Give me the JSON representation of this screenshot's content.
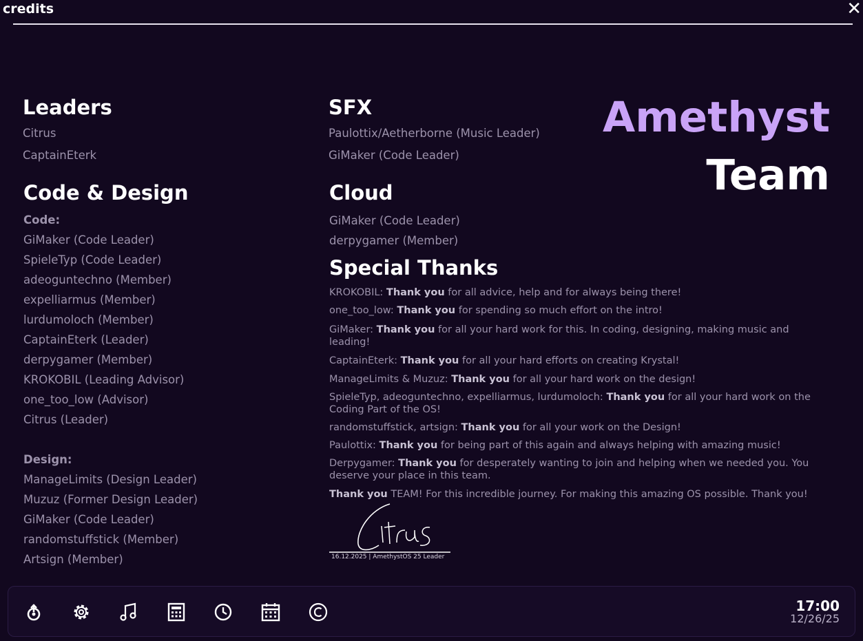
{
  "window": {
    "title": "credits",
    "close_symbol": "✕"
  },
  "colors": {
    "background": "#12081f",
    "accent": "#c9a3f7",
    "muted_text": "#9c92ab"
  },
  "leaders": {
    "heading": "Leaders",
    "items": [
      "Citrus",
      "CaptainEterk"
    ]
  },
  "code_design": {
    "heading": "Code & Design",
    "code_label": "Code:",
    "code_items": [
      "GiMaker (Code Leader)",
      "SpieleTyp (Code Leader)",
      "adeoguntechno (Member)",
      "expelliarmus (Member)",
      "lurdumoloch (Member)",
      "CaptainEterk (Leader)",
      "derpygamer (Member)",
      "KROKOBIL (Leading Advisor)",
      "one_too_low (Advisor)",
      "Citrus (Leader)"
    ],
    "design_label": "Design:",
    "design_items": [
      "ManageLimits (Design Leader)",
      "Muzuz (Former Design Leader)",
      "GiMaker (Code Leader)",
      "randomstuffstick (Member)",
      "Artsign (Member)"
    ]
  },
  "sfx": {
    "heading": "SFX",
    "items": [
      "Paulottix/Aetherborne (Music Leader)",
      "GiMaker (Code Leader)"
    ]
  },
  "cloud": {
    "heading": "Cloud",
    "items": [
      "GiMaker (Code Leader)",
      "derpygamer (Member)"
    ]
  },
  "special_thanks": {
    "heading": "Special Thanks",
    "entries": [
      {
        "name": "KROKOBIL: ",
        "bold": "Thank you",
        "rest": " for all advice, help and for always being there!"
      },
      {
        "name": "one_too_low: ",
        "bold": "Thank you",
        "rest": " for spending so much effort on the intro!"
      },
      {
        "name": "GiMaker: ",
        "bold": "Thank you",
        "rest": " for all your hard work for this. In coding, designing, making music and leading!"
      },
      {
        "name": "CaptainEterk: ",
        "bold": "Thank you",
        "rest": " for all your hard efforts on creating Krystal!"
      },
      {
        "name": "ManageLimits & Muzuz: ",
        "bold": "Thank you",
        "rest": " for all your hard work on the design!"
      },
      {
        "name": "SpieleTyp, adeoguntechno, expelliarmus, lurdumoloch: ",
        "bold": "Thank you",
        "rest": " for all your hard work on the Coding Part of the OS!"
      },
      {
        "name": "randomstuffstick, artsign: ",
        "bold": "Thank you",
        "rest": " for all your work on the Design!"
      },
      {
        "name": "Paulottix: ",
        "bold": "Thank you",
        "rest": " for being part of this again and always helping with amazing music!"
      },
      {
        "name": "Derpygamer: ",
        "bold": "Thank you",
        "rest": " for desperately wanting to join and helping when we needed you. You deserve your place in this team."
      },
      {
        "name": "",
        "bold": "Thank you",
        "rest": " TEAM! For this incredible journey. For making this amazing OS possible. Thank you!"
      }
    ]
  },
  "brand": {
    "line1": "Amethyst",
    "line2": "Team"
  },
  "signature": {
    "caption": "16.12.2025 | AmethystOS 25 Leader"
  },
  "taskbar": {
    "icons": [
      "launcher-icon",
      "gear-icon",
      "music-note-icon",
      "calculator-icon",
      "clock-icon",
      "calendar-icon",
      "copyright-icon"
    ],
    "time": "17:00",
    "date": "12/26/25"
  }
}
